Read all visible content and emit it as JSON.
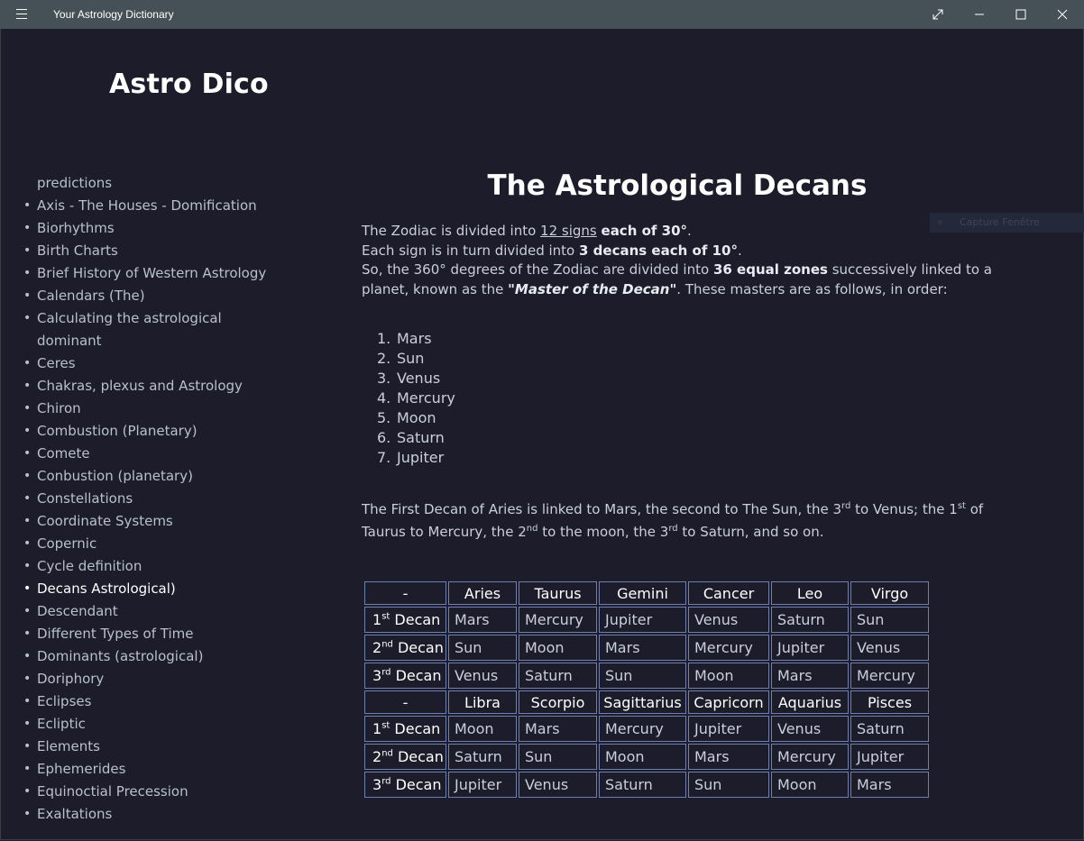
{
  "window": {
    "title": "Your Astrology Dictionary"
  },
  "brand": "Astro Dico",
  "sidebar": {
    "items": [
      {
        "label": "predictions",
        "bullet": false
      },
      {
        "label": "Axis - The Houses - Domification",
        "bullet": true
      },
      {
        "label": "Biorhythms",
        "bullet": true
      },
      {
        "label": "Birth Charts",
        "bullet": true
      },
      {
        "label": "Brief History of Western Astrology",
        "bullet": true
      },
      {
        "label": "Calendars (The)",
        "bullet": true
      },
      {
        "label": "Calculating the astrological",
        "bullet": true
      },
      {
        "label": "dominant",
        "bullet": false
      },
      {
        "label": "Ceres",
        "bullet": true
      },
      {
        "label": "Chakras, plexus and Astrology",
        "bullet": true
      },
      {
        "label": "Chiron",
        "bullet": true
      },
      {
        "label": "Combustion (Planetary)",
        "bullet": true
      },
      {
        "label": "Comete",
        "bullet": true
      },
      {
        "label": "Conbustion (planetary)",
        "bullet": true
      },
      {
        "label": "Constellations",
        "bullet": true
      },
      {
        "label": "Coordinate Systems",
        "bullet": true
      },
      {
        "label": "Copernic",
        "bullet": true
      },
      {
        "label": "Cycle definition",
        "bullet": true
      },
      {
        "label": "Decans Astrological)",
        "bullet": true,
        "active": true
      },
      {
        "label": "Descendant",
        "bullet": true
      },
      {
        "label": "Different Types of Time",
        "bullet": true
      },
      {
        "label": "Dominants (astrological)",
        "bullet": true
      },
      {
        "label": "Doriphory",
        "bullet": true
      },
      {
        "label": "Eclipses",
        "bullet": true
      },
      {
        "label": "Ecliptic",
        "bullet": true
      },
      {
        "label": "Elements",
        "bullet": true
      },
      {
        "label": "Ephemerides",
        "bullet": true
      },
      {
        "label": "Equinoctial Precession",
        "bullet": true
      },
      {
        "label": "Exaltations",
        "bullet": true
      }
    ]
  },
  "article": {
    "title": "The Astrological Decans",
    "intro": {
      "p1a": "The Zodiac is divided into ",
      "p1_link": "12 signs",
      "p1b": " ",
      "p1_bold": "each of 30°",
      "p1c": ".",
      "p2a": "Each sign is in turn divided into ",
      "p2_bold": "3 decans each of 10°",
      "p2b": ".",
      "p3a": "So, the 360° degrees of the Zodiac are divided into ",
      "p3_bold": "36 equal zones",
      "p3b": " successively linked to a planet, known as the ",
      "p3_bolditalic": "\"Master of the Decan\"",
      "p3c": ". These masters are as follows, in order:"
    },
    "planets": [
      "Mars",
      "Sun",
      "Venus",
      "Mercury",
      "Moon",
      "Saturn",
      "Jupiter"
    ],
    "planet_numbers": [
      "1.",
      "2.",
      "3.",
      "4.",
      "5.",
      "6.",
      "7."
    ],
    "linking": {
      "a": "The First Decan of Aries is linked to Mars, the second to The Sun, the 3",
      "a_sup": "rd",
      "b": " to Venus; the 1",
      "b_sup": "st",
      "c": " of Taurus to Mercury, the 2",
      "c_sup": "nd",
      "d": " to the moon, the 3",
      "d_sup": "rd",
      "e": " to Saturn, and so on."
    },
    "table": {
      "blocks": [
        {
          "corner": "-",
          "signs": [
            "Aries",
            "Taurus",
            "Gemini",
            "Cancer",
            "Leo",
            "Virgo"
          ],
          "rows": [
            {
              "num": "1",
              "sup": "st",
              "word": " Decan",
              "cells": [
                "Mars",
                "Mercury",
                "Jupiter",
                "Venus",
                "Saturn",
                "Sun"
              ]
            },
            {
              "num": "2",
              "sup": "nd",
              "word": " Decan",
              "cells": [
                "Sun",
                "Moon",
                "Mars",
                "Mercury",
                "Jupiter",
                "Venus"
              ]
            },
            {
              "num": "3",
              "sup": "rd",
              "word": " Decan",
              "cells": [
                "Venus",
                "Saturn",
                "Sun",
                "Moon",
                "Mars",
                "Mercury"
              ]
            }
          ]
        },
        {
          "corner": "-",
          "signs": [
            "Libra",
            "Scorpio",
            "Sagittarius",
            "Capricorn",
            "Aquarius",
            "Pisces"
          ],
          "rows": [
            {
              "num": "1",
              "sup": "st",
              "word": " Decan",
              "cells": [
                "Moon",
                "Mars",
                "Mercury",
                "Jupiter",
                "Venus",
                "Saturn"
              ]
            },
            {
              "num": "2",
              "sup": "nd",
              "word": " Decan",
              "cells": [
                "Saturn",
                "Sun",
                "Moon",
                "Mars",
                "Mercury",
                "Jupiter"
              ]
            },
            {
              "num": "3",
              "sup": "rd",
              "word": " Decan",
              "cells": [
                "Jupiter",
                "Venus",
                "Saturn",
                "Sun",
                "Moon",
                "Mars"
              ]
            }
          ]
        }
      ]
    }
  },
  "overlay": {
    "capture_label": "Capture Fenêtre"
  }
}
